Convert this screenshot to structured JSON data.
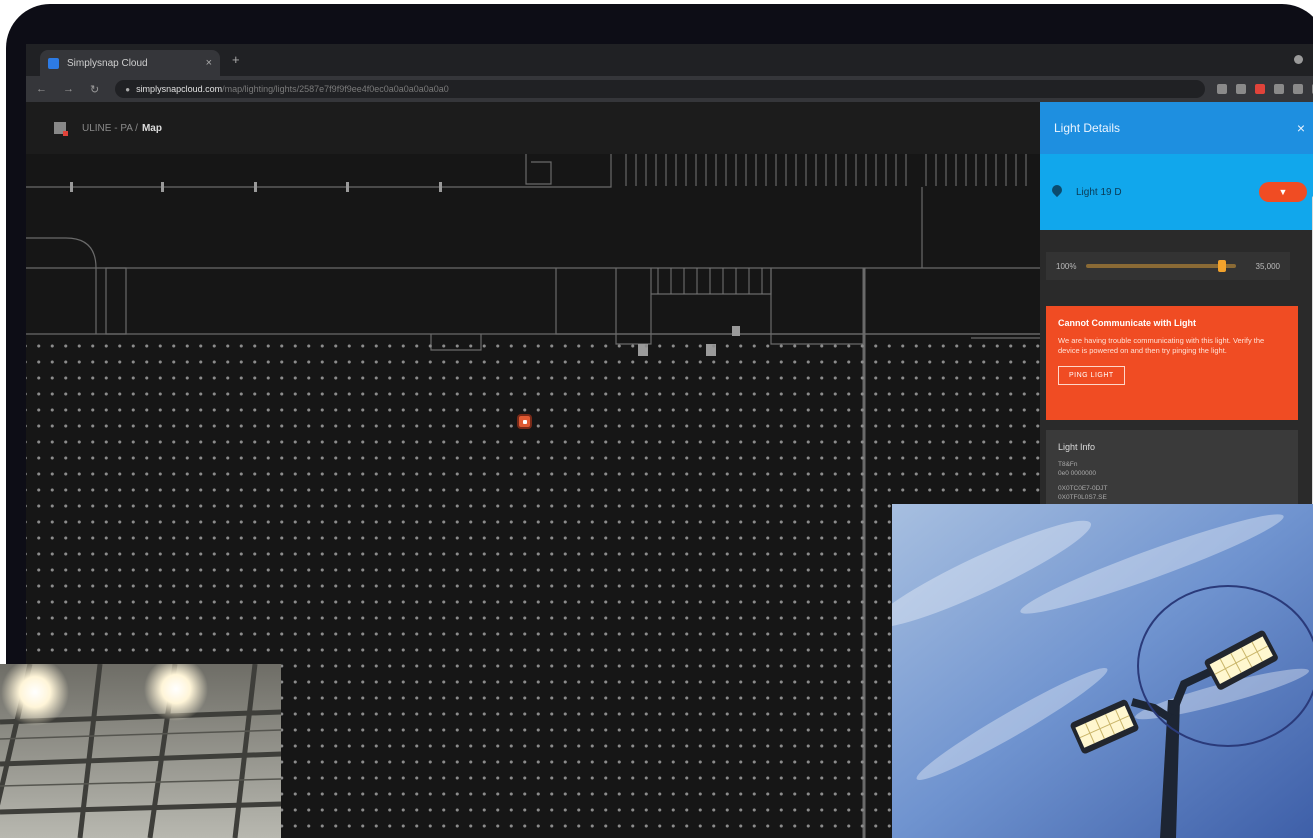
{
  "browser": {
    "tab_title": "Simplysnap Cloud",
    "tab_close": "×",
    "new_tab": "+",
    "url_host": "simplysnapcloud.com",
    "url_path": "/map/lighting/lights/2587e7f9f9f9ee4f0ec0a0a0a0a0a0a0",
    "nav_back": "←",
    "nav_forward": "→",
    "nav_reload": "↻"
  },
  "app_header": {
    "breadcrumb": "ULINE - PA /",
    "current": "Map"
  },
  "panel": {
    "title": "Light Details",
    "close": "×",
    "light_name": "Light 19 D",
    "dim_level": "100%",
    "dim_value": "35,000",
    "alert": {
      "title": "Cannot Communicate with Light",
      "body": "We are having trouble communicating with this light. Verify the device is powered on and then try pinging the light.",
      "ping_button": "PING LIGHT"
    },
    "info": {
      "title": "Light Info",
      "lines": [
        "T8&Fn",
        "0e0 0000000",
        "0X0TC0E7-0DJT",
        "0X0TF0L0S7.SE"
      ]
    }
  },
  "colors": {
    "panel_header": "#1e8fe0",
    "light_row": "#11a7ec",
    "alert": "#f04c23",
    "selected_light": "#e05a33"
  }
}
